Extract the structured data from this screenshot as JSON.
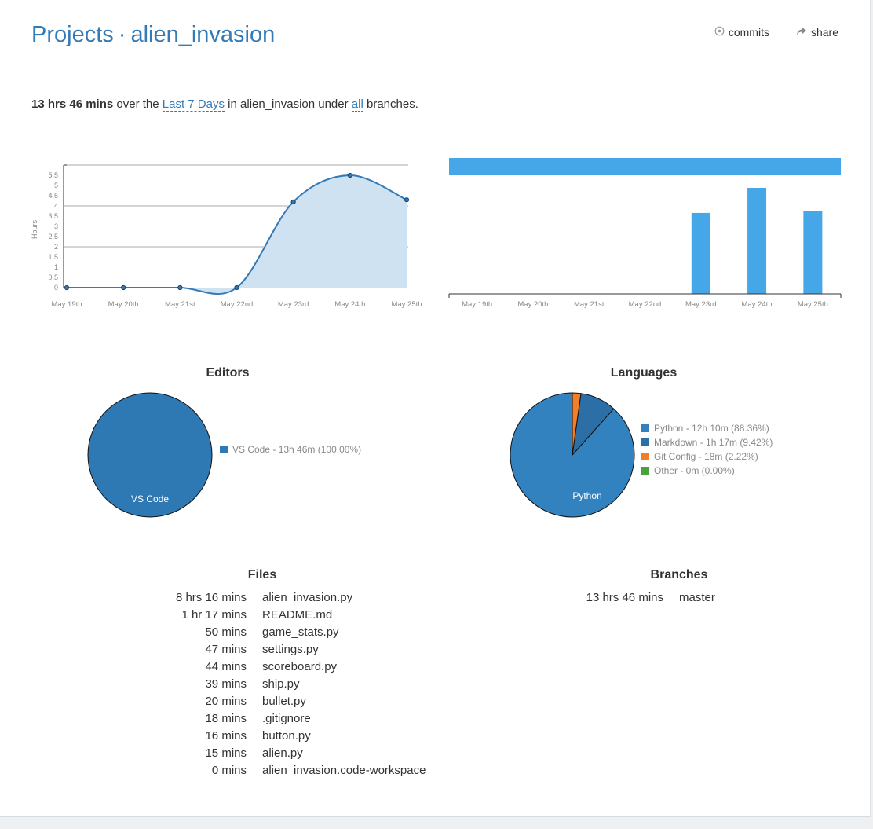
{
  "header": {
    "projects_link": "Projects",
    "separator": "·",
    "project_name": "alien_invasion",
    "commits_label": "commits",
    "share_label": "share"
  },
  "summary": {
    "total": "13 hrs 46 mins",
    "text_over": "over the",
    "range_link": "Last 7 Days",
    "text_in": "in alien_invasion under",
    "branches_link": "all",
    "text_end": "branches."
  },
  "chart_data": [
    {
      "type": "area",
      "title": "",
      "xlabel": "",
      "ylabel": "Hours",
      "categories": [
        "May 19th",
        "May 20th",
        "May 21st",
        "May 22nd",
        "May 23rd",
        "May 24th",
        "May 25th"
      ],
      "values": [
        0,
        0,
        0,
        0,
        4.2,
        5.5,
        4.3
      ],
      "ylim": [
        0,
        6
      ],
      "yticks": [
        0,
        0.5,
        1,
        1.5,
        2,
        2.5,
        3,
        3.5,
        4,
        4.5,
        5,
        5.5
      ],
      "grid": true,
      "color": "#337ab7",
      "fill": "#cfe2f1"
    },
    {
      "type": "bar",
      "title": "",
      "categories": [
        "May 19th",
        "May 20th",
        "May 21st",
        "May 22nd",
        "May 23rd",
        "May 24th",
        "May 25th"
      ],
      "values": [
        0,
        0,
        0,
        0,
        4.2,
        5.5,
        4.3
      ],
      "ylim": [
        0,
        5.5
      ],
      "color": "#45a6e8"
    },
    {
      "type": "pie",
      "title": "Editors",
      "slices": [
        {
          "label": "VS Code",
          "legend": "VS Code - 13h 46m (100.00%)",
          "value": 100.0,
          "color": "#2e78b4"
        }
      ]
    },
    {
      "type": "pie",
      "title": "Languages",
      "slices": [
        {
          "label": "Python",
          "legend": "Python - 12h 10m (88.36%)",
          "value": 88.36,
          "color": "#3282c0"
        },
        {
          "label": "Markdown",
          "legend": "Markdown - 1h 17m (9.42%)",
          "value": 9.42,
          "color": "#2c6ea6"
        },
        {
          "label": "Git Config",
          "legend": "Git Config - 18m (2.22%)",
          "value": 2.22,
          "color": "#f07f2a"
        },
        {
          "label": "Other",
          "legend": "Other - 0m (0.00%)",
          "value": 0.0,
          "color": "#4aa13c"
        }
      ]
    }
  ],
  "files": {
    "title": "Files",
    "rows": [
      {
        "duration": "8 hrs 16 mins",
        "name": "alien_invasion.py"
      },
      {
        "duration": "1 hr 17 mins",
        "name": "README.md"
      },
      {
        "duration": "50 mins",
        "name": "game_stats.py"
      },
      {
        "duration": "47 mins",
        "name": "settings.py"
      },
      {
        "duration": "44 mins",
        "name": "scoreboard.py"
      },
      {
        "duration": "39 mins",
        "name": "ship.py"
      },
      {
        "duration": "20 mins",
        "name": "bullet.py"
      },
      {
        "duration": "18 mins",
        "name": ".gitignore"
      },
      {
        "duration": "16 mins",
        "name": "button.py"
      },
      {
        "duration": "15 mins",
        "name": "alien.py"
      },
      {
        "duration": "0 mins",
        "name": "alien_invasion.code-workspace"
      }
    ]
  },
  "branches": {
    "title": "Branches",
    "rows": [
      {
        "duration": "13 hrs 46 mins",
        "name": "master"
      }
    ]
  }
}
